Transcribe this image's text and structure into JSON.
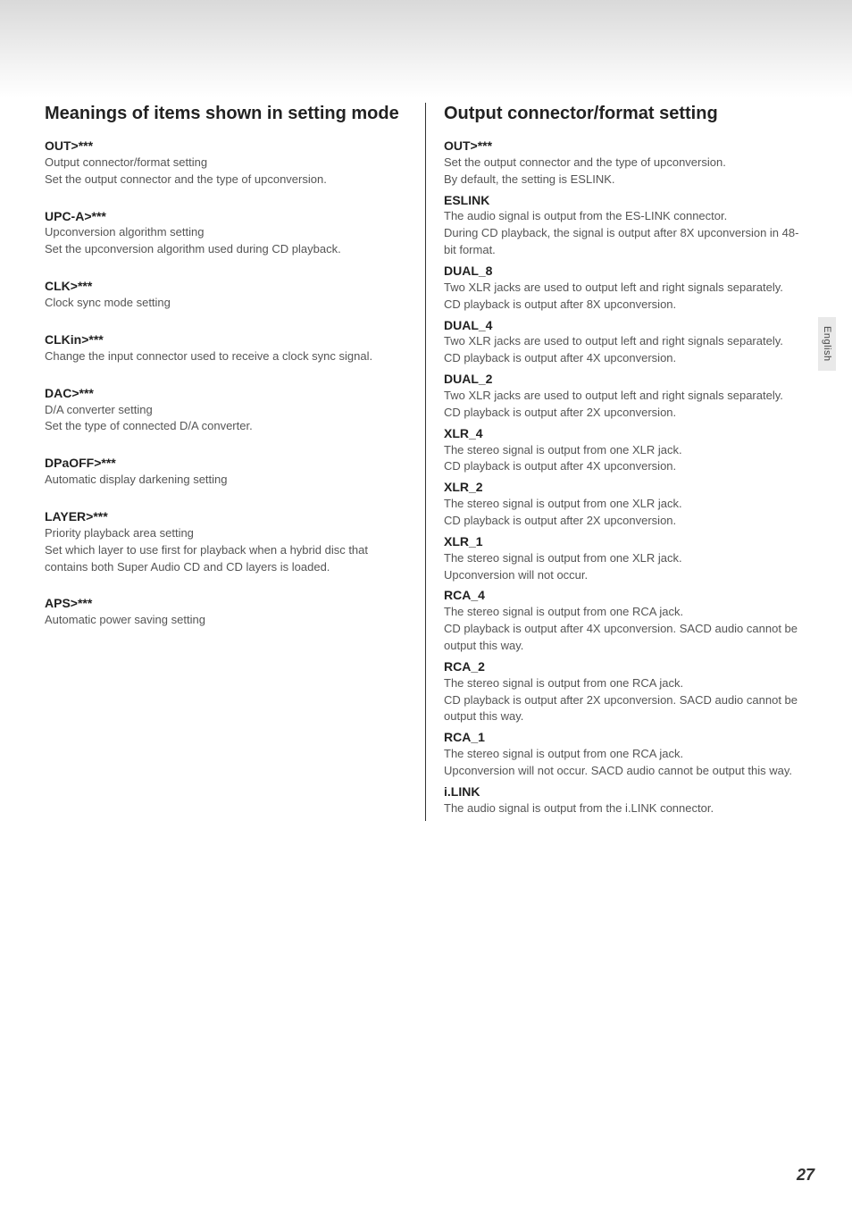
{
  "sideTab": "English",
  "pageNumber": "27",
  "left": {
    "heading": "Meanings of items shown in setting mode",
    "items": [
      {
        "term": "OUT>***",
        "lines": [
          "Output connector/format setting",
          "Set the output connector and the type of upconversion."
        ]
      },
      {
        "term": "UPC-A>***",
        "lines": [
          "Upconversion algorithm setting",
          "Set the upconversion algorithm used during CD playback."
        ]
      },
      {
        "term": "CLK>***",
        "lines": [
          "Clock sync mode setting"
        ]
      },
      {
        "term": "CLKin>***",
        "lines": [
          "Change the input connector used to receive a clock sync signal."
        ]
      },
      {
        "term": "DAC>***",
        "lines": [
          "D/A converter setting",
          "Set the type of connected D/A converter."
        ]
      },
      {
        "term": "DPaOFF>***",
        "lines": [
          "Automatic display darkening setting"
        ]
      },
      {
        "term": "LAYER>***",
        "lines": [
          "Priority playback area setting",
          "Set which layer to use first for playback when a hybrid disc that contains both Super Audio CD and CD layers is loaded."
        ]
      },
      {
        "term": "APS>***",
        "lines": [
          "Automatic power saving setting"
        ]
      }
    ]
  },
  "right": {
    "heading": "Output connector/format setting",
    "intro": {
      "term": "OUT>***",
      "lines": [
        "Set the output connector and the type of upconversion.",
        "By default, the setting is ESLINK."
      ]
    },
    "options": [
      {
        "term": "ESLINK",
        "lines": [
          "The audio signal is output from the ES-LINK connector.",
          "During CD playback, the signal is output after 8X upconversion in 48-bit format."
        ]
      },
      {
        "term": "DUAL_8",
        "lines": [
          "Two XLR jacks are used to output left and right signals separately.",
          "CD playback is output after 8X upconversion."
        ]
      },
      {
        "term": "DUAL_4",
        "lines": [
          "Two XLR jacks are used to output left and right signals separately.",
          "CD playback is output after 4X upconversion."
        ]
      },
      {
        "term": "DUAL_2",
        "lines": [
          "Two XLR jacks are used to output left and right signals separately.",
          "CD playback is output after 2X upconversion."
        ]
      },
      {
        "term": "XLR_4",
        "lines": [
          "The stereo signal is output from one XLR jack.",
          "CD playback is output after 4X upconversion."
        ]
      },
      {
        "term": "XLR_2",
        "lines": [
          "The stereo signal is output from one XLR jack.",
          "CD playback is output after 2X upconversion."
        ]
      },
      {
        "term": "XLR_1",
        "lines": [
          "The stereo signal is output from one XLR jack.",
          "Upconversion will not occur."
        ]
      },
      {
        "term": "RCA_4",
        "lines": [
          "The stereo signal is output from one RCA jack.",
          "CD playback is output after 4X upconversion. SACD audio cannot be output this way."
        ]
      },
      {
        "term": "RCA_2",
        "lines": [
          "The stereo signal is output from one RCA jack.",
          "CD playback is output after 2X upconversion. SACD audio cannot be output this way."
        ]
      },
      {
        "term": "RCA_1",
        "lines": [
          "The stereo signal is output from one RCA jack.",
          "Upconversion will not occur. SACD audio cannot be output this way."
        ]
      },
      {
        "term": "i.LINK",
        "lines": [
          "The audio signal is output from the i.LINK connector."
        ]
      }
    ]
  }
}
